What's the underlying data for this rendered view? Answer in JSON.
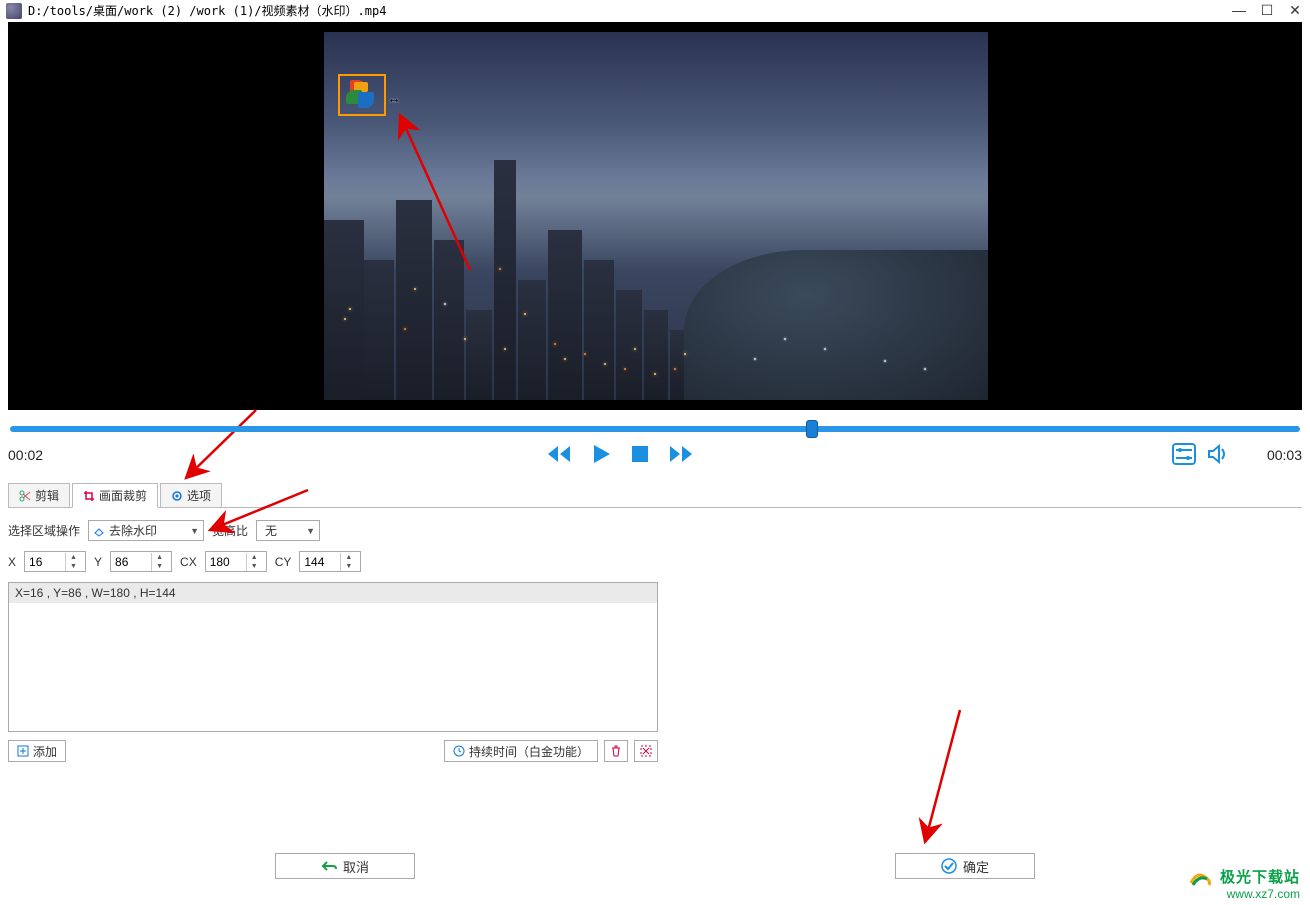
{
  "titlebar": {
    "title": "D:/tools/桌面/work (2) /work (1)/视频素材（水印）.mp4"
  },
  "progress": {
    "current_time": "00:02",
    "total_time": "00:03"
  },
  "tabs": {
    "edit": "剪辑",
    "crop": "画面裁剪",
    "options": "选项"
  },
  "crop_panel": {
    "region_op_label": "选择区域操作",
    "region_op_value": "去除水印",
    "aspect_label": "宽高比",
    "aspect_value": "无",
    "x_label": "X",
    "x_value": "16",
    "y_label": "Y",
    "y_value": "86",
    "cx_label": "CX",
    "cx_value": "180",
    "cy_label": "CY",
    "cy_value": "144",
    "list_entry": "X=16 , Y=86 , W=180 , H=144",
    "add_btn": "添加",
    "duration_btn": "持续时间（白金功能）"
  },
  "buttons": {
    "cancel": "取消",
    "ok": "确定"
  },
  "footer": {
    "line1": "极光下载站",
    "line2": "www.xz7.com"
  }
}
